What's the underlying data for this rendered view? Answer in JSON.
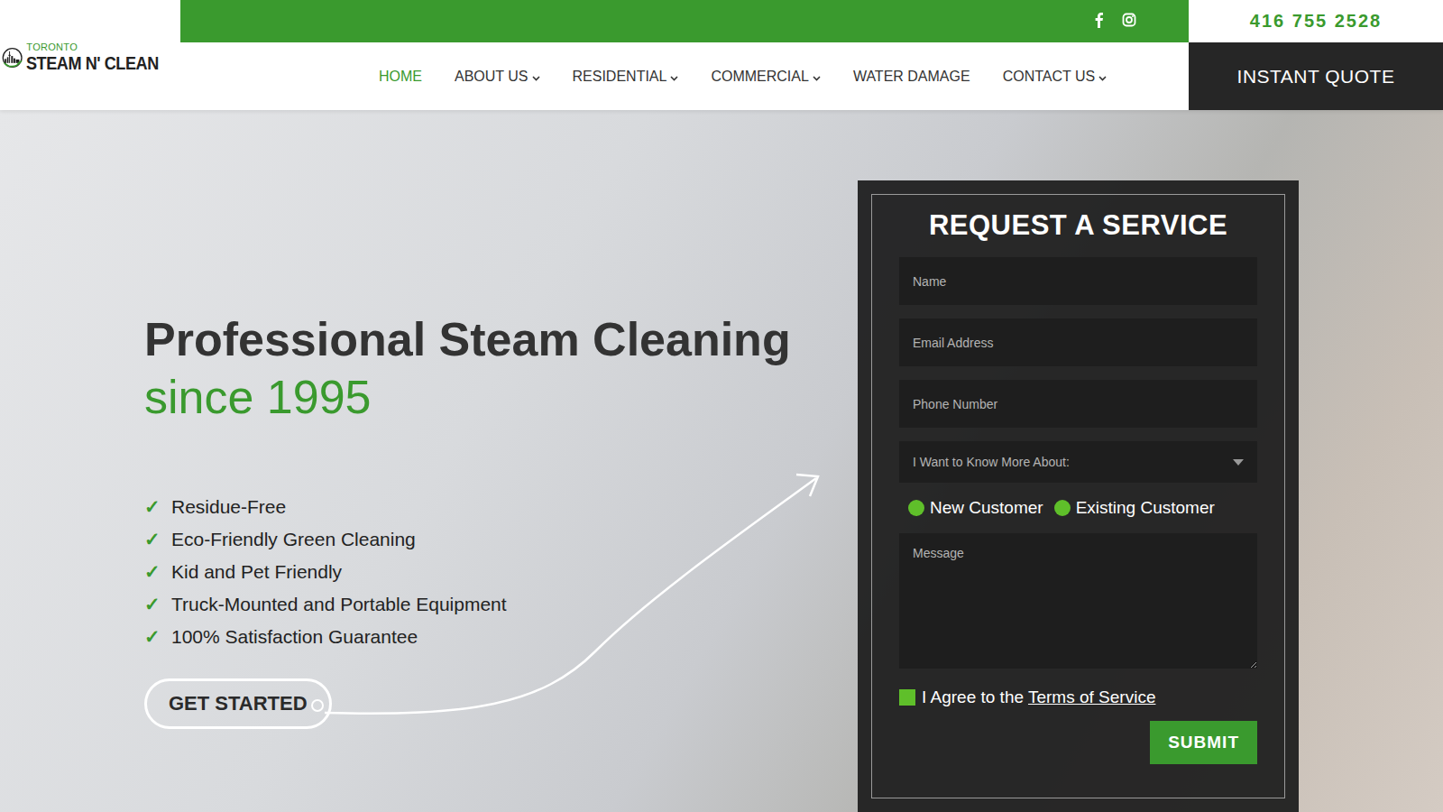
{
  "header": {
    "logo": {
      "small": "TORONTO",
      "main": "STEAM N' CLEAN"
    },
    "phone": "416 755 2528",
    "nav": [
      {
        "label": "HOME",
        "selected": true,
        "has_dropdown": false
      },
      {
        "label": "ABOUT US",
        "selected": false,
        "has_dropdown": true
      },
      {
        "label": "RESIDENTIAL",
        "selected": false,
        "has_dropdown": true
      },
      {
        "label": "COMMERCIAL",
        "selected": false,
        "has_dropdown": true
      },
      {
        "label": "WATER DAMAGE",
        "selected": false,
        "has_dropdown": false
      },
      {
        "label": "CONTACT US",
        "selected": false,
        "has_dropdown": true
      }
    ],
    "cta": "INSTANT QUOTE"
  },
  "hero": {
    "title": "Professional Steam Cleaning",
    "subtitle": "since 1995",
    "features": [
      {
        "icon": "✓",
        "text": "Residue-Free"
      },
      {
        "icon": "✓",
        "text": "Eco-Friendly Green Cleaning"
      },
      {
        "icon": "✓",
        "text": "Kid and Pet Friendly"
      },
      {
        "icon": "✓",
        "text": "Truck-Mounted and Portable Equipment"
      },
      {
        "icon": "✓",
        "text": "100% Satisfaction Guarantee"
      }
    ],
    "button": "GET STARTED"
  },
  "form": {
    "title": "REQUEST A SERVICE",
    "fields": [
      {
        "placeholder": "Name"
      },
      {
        "placeholder": "Email Address"
      },
      {
        "placeholder": "Phone Number"
      }
    ],
    "select": "I Want to Know More About:",
    "customer_type": [
      {
        "label": "New Customer",
        "selected": false
      },
      {
        "label": "Existing Customer",
        "selected": false
      }
    ],
    "message_placeholder": "Message",
    "agree": {
      "text": "I Agree to the ",
      "link": "Terms of Service",
      "checked": false
    },
    "submit": "SUBMIT"
  }
}
